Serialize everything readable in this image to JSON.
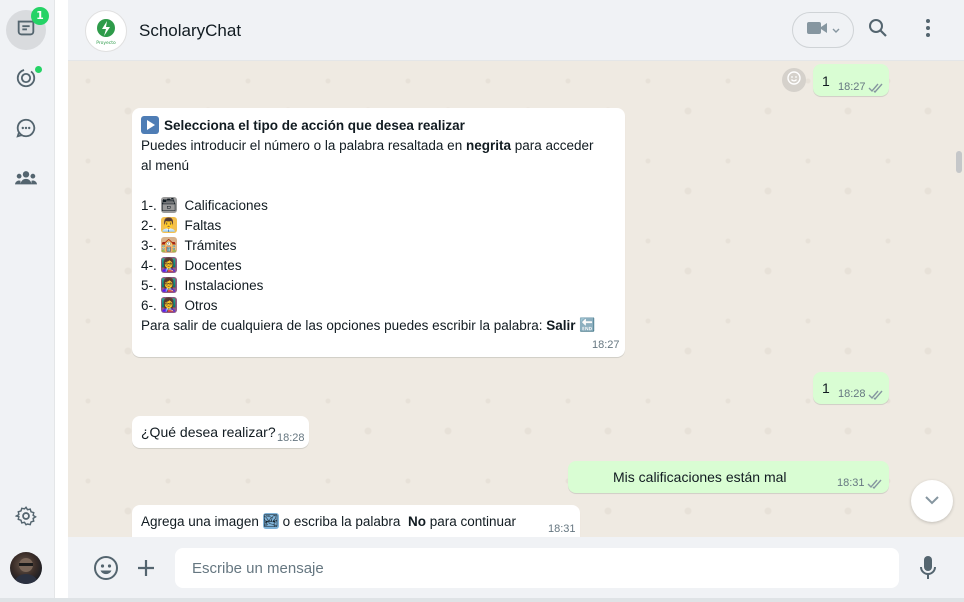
{
  "rail": {
    "chats_badge": "1",
    "items": [
      "chats",
      "status",
      "channels",
      "communities",
      "settings",
      "profile"
    ]
  },
  "header": {
    "title": "ScholaryChat",
    "logo_text": "Proyecto"
  },
  "messages": [
    {
      "dir": "out",
      "text": "1",
      "time": "18:27"
    },
    {
      "dir": "in",
      "heading": "Selecciona el tipo de acción que desea realizar",
      "intro_pre": "Puedes introducir el número o la palabra resaltada en",
      "intro_bold": "negrita",
      "intro_post": "para acceder",
      "intro_line2": "al menú",
      "options": [
        {
          "num": "1-.",
          "label": "Calificaciones",
          "emoji": "🗃"
        },
        {
          "num": "2-.",
          "label": "Faltas",
          "emoji": "👨‍💼"
        },
        {
          "num": "3-.",
          "label": "Trámites",
          "emoji": "🏫"
        },
        {
          "num": "4-.",
          "label": "Docentes",
          "emoji": "👩‍🏫"
        },
        {
          "num": "5-.",
          "label": "Instalaciones",
          "emoji": "👩‍🏫"
        },
        {
          "num": "6-.",
          "label": "Otros",
          "emoji": "👩‍🏫"
        }
      ],
      "exit_pre": "Para salir de cualquiera de las opciones puedes escribir la palabra:",
      "exit_bold": "Salir",
      "exit_emoji": "🔚",
      "time": "18:27"
    },
    {
      "dir": "out",
      "text": "1",
      "time": "18:28"
    },
    {
      "dir": "in",
      "text": "¿Qué desea realizar?",
      "time": "18:28"
    },
    {
      "dir": "out",
      "text": "Mis calificaciones están mal",
      "time": "18:31"
    },
    {
      "dir": "in",
      "pre": "Agrega una imagen",
      "emoji": "🏞",
      "mid": "o  escriba la palabra",
      "bold": "No",
      "post": "para continuar",
      "time": "18:31"
    }
  ],
  "composer": {
    "placeholder": "Escribe un mensaje"
  },
  "colors": {
    "incoming": "#ffffff",
    "outgoing": "#d9fdd3",
    "chat_bg": "#efeae2",
    "accent": "#25d366",
    "read_ticks": "#53bdeb"
  }
}
